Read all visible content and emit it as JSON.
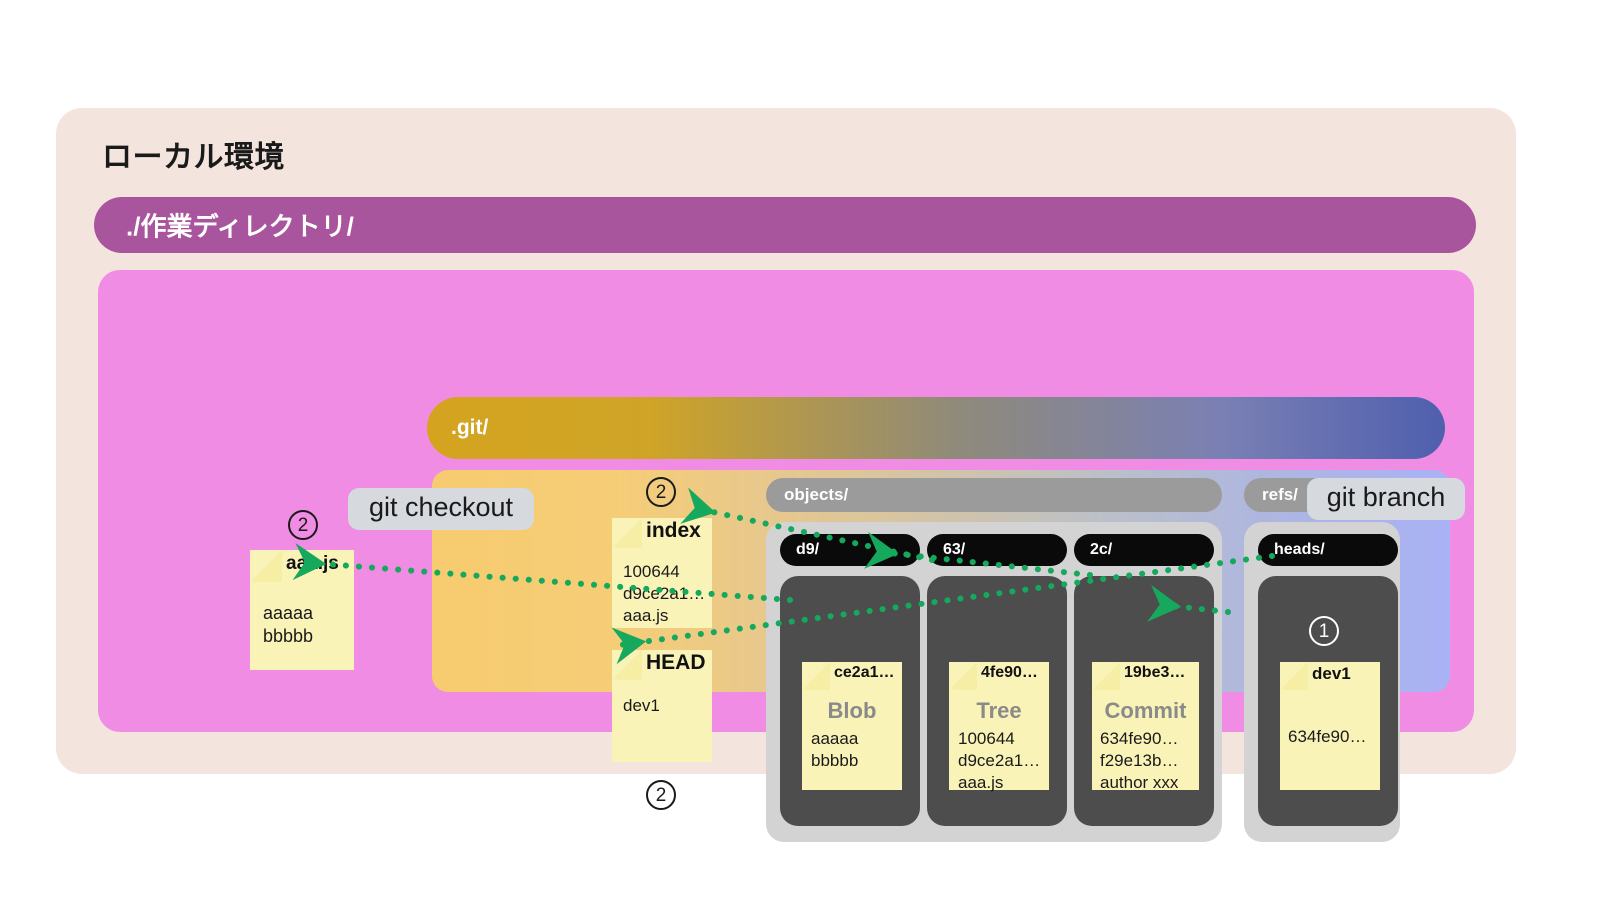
{
  "diagram": {
    "title": "ローカル環境",
    "accent_green": "#16a85c",
    "card_yellow": "#faf3b8",
    "magenta": "#f08ce4",
    "purple": "#a9559d",
    "shell_pink": "#f4e4de"
  },
  "working_directory": {
    "label": "./作業ディレクトリ/",
    "step_badge": "2",
    "file": {
      "title": "aaa.js",
      "lines": [
        "aaaaa",
        "bbbbb"
      ]
    }
  },
  "git_dir": {
    "label": ".git/",
    "index": {
      "step_badge_top": "2",
      "step_badge_bottom": "2",
      "title": "index",
      "lines": [
        "100644",
        "d9ce2a1…",
        "aaa.js"
      ]
    },
    "head": {
      "title": "HEAD",
      "lines": [
        "dev1"
      ]
    }
  },
  "objects": {
    "label": "objects/",
    "folders": [
      {
        "name": "d9/",
        "object": {
          "hash": "ce2a1…",
          "type": "Blob",
          "lines": [
            "aaaaa",
            "bbbbb"
          ]
        }
      },
      {
        "name": "63/",
        "object": {
          "hash": "4fe90…",
          "type": "Tree",
          "lines": [
            "100644",
            "d9ce2a1…",
            "aaa.js"
          ]
        }
      },
      {
        "name": "2c/",
        "object": {
          "hash": "19be3…",
          "type": "Commit",
          "lines": [
            "634fe90…",
            "f29e13b…",
            "author xxx"
          ]
        }
      }
    ]
  },
  "refs": {
    "label": "refs/",
    "heads": {
      "label": "heads/",
      "step_badge": "1",
      "ref": {
        "title": "dev1",
        "lines": [
          "634fe90…"
        ]
      }
    }
  },
  "commands": {
    "checkout": "git checkout",
    "branch": "git branch"
  }
}
